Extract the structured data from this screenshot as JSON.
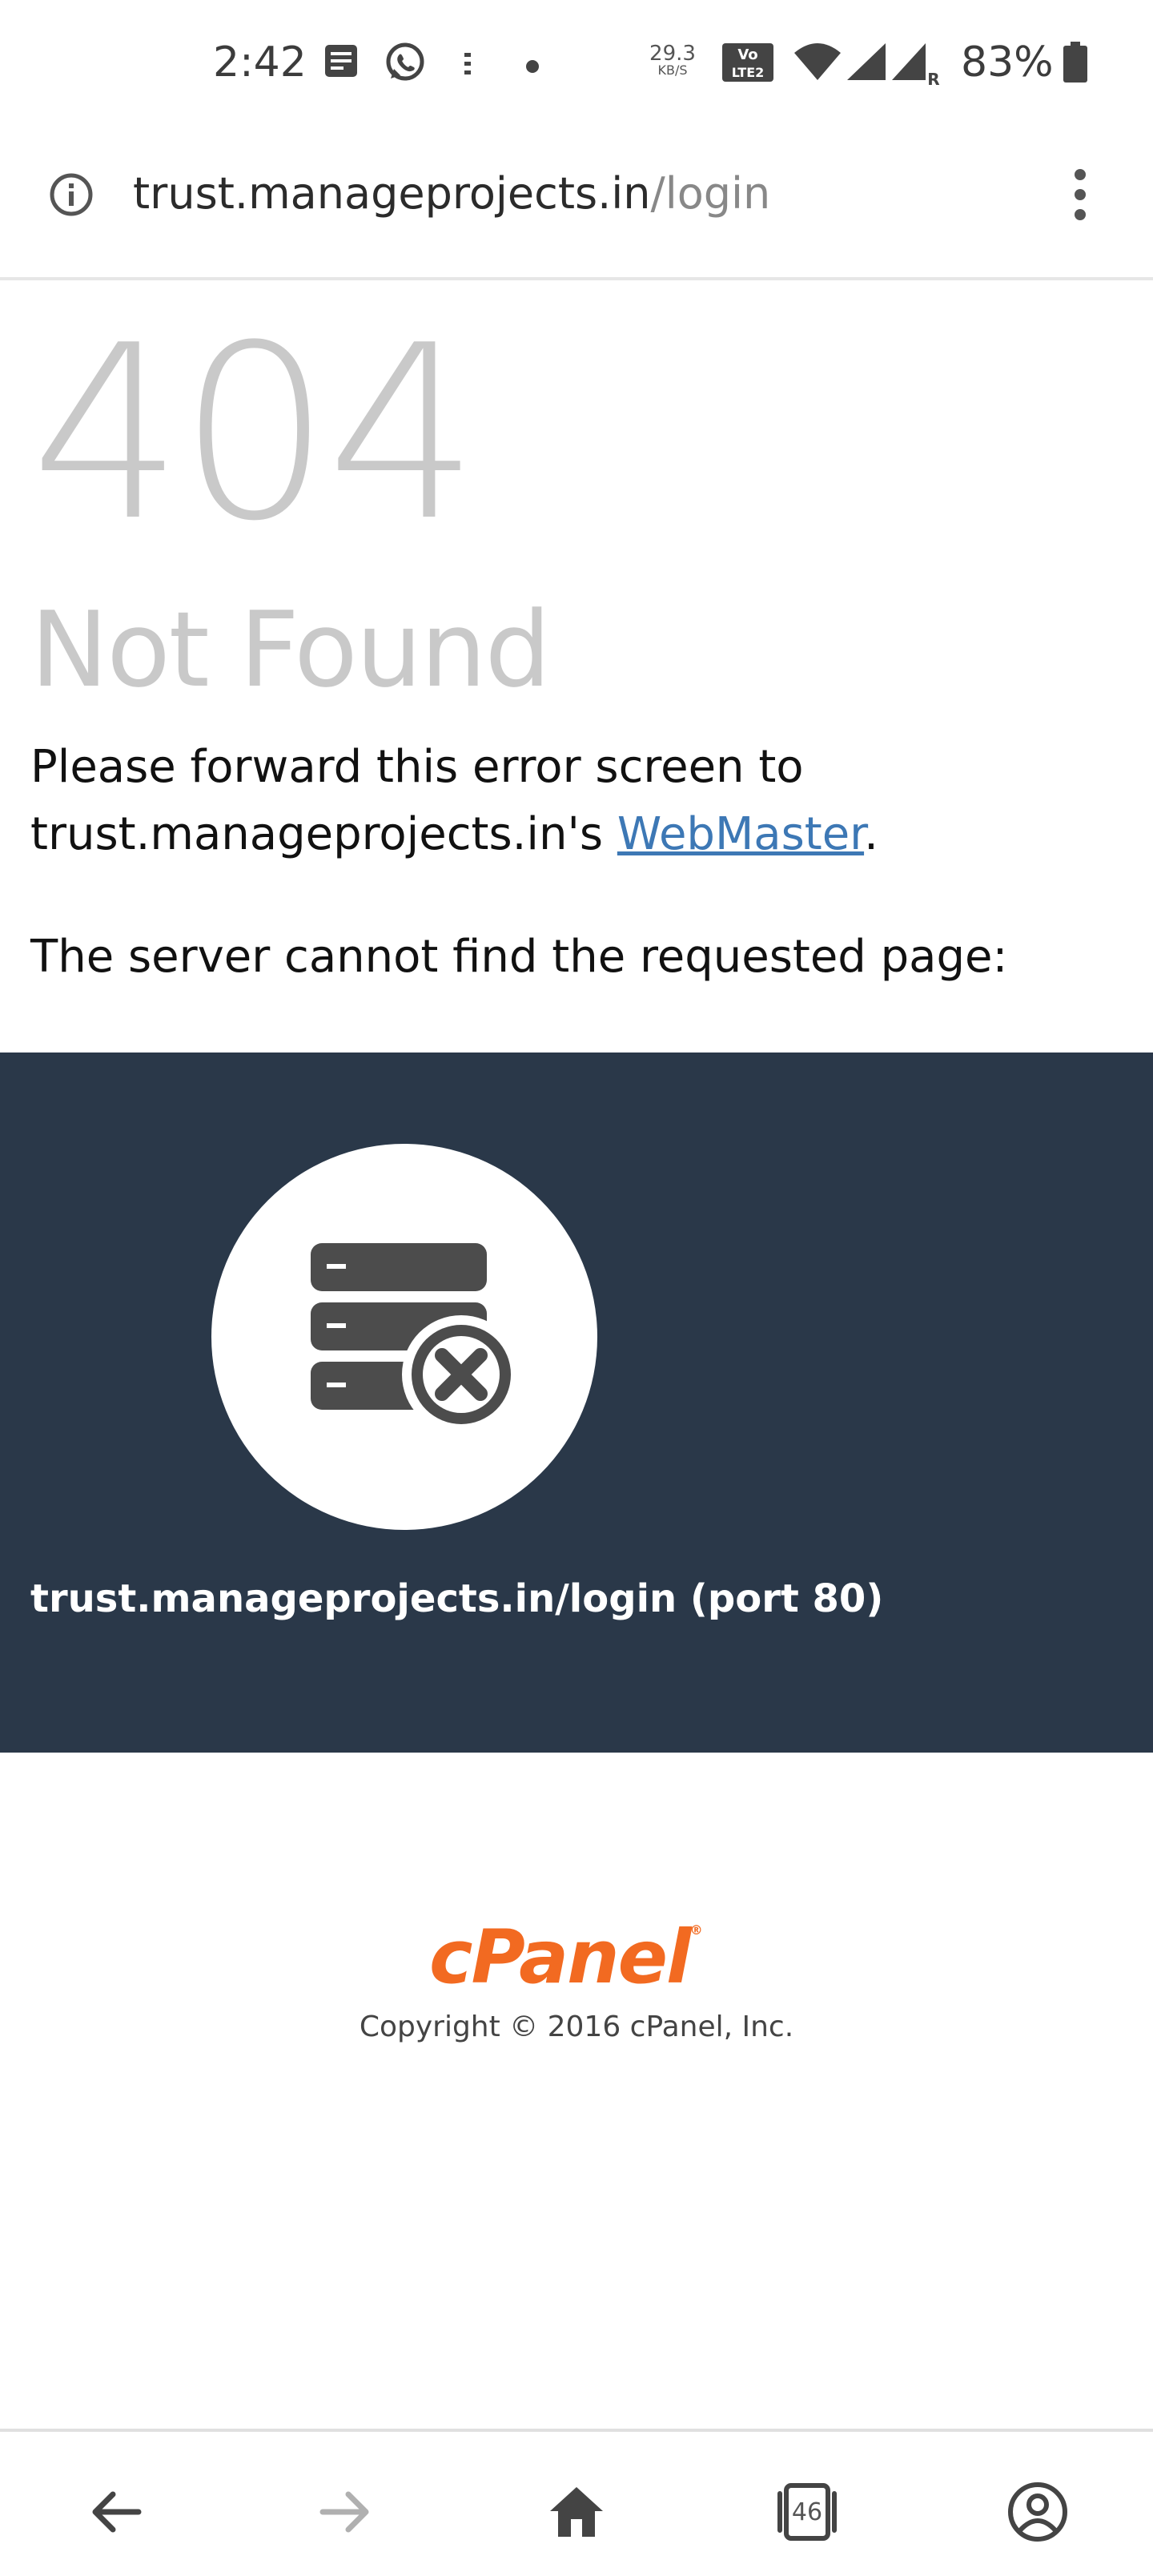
{
  "status_bar": {
    "time": "2:42",
    "net_speed_value": "29.3",
    "net_speed_unit": "KB/S",
    "battery": "83%",
    "icons": [
      "notes-icon",
      "whatsapp-icon",
      "more-notifications-icon",
      "dot-icon",
      "volte-icon",
      "wifi-icon",
      "signal-icon",
      "signal-roaming-icon",
      "battery-icon"
    ]
  },
  "url_bar": {
    "domain": "trust.manageprojects.in",
    "path": "/login"
  },
  "error": {
    "code": "404",
    "title": "Not Found",
    "forward_text": "Please forward this error screen to trust.manageprojects.in's",
    "webmaster_link": "WebMaster",
    "period": ".",
    "server_text": "The server cannot find the requested page:"
  },
  "panel": {
    "requested": "trust.manageprojects.in/login (port 80)",
    "bg_color": "#2a3849"
  },
  "footer": {
    "logo": "cPanel",
    "logo_mark": "®",
    "copyright": "Copyright © 2016 cPanel, Inc.",
    "brand_color": "#f26a21"
  },
  "bottom_nav": {
    "tab_count": "46",
    "items": [
      "back-icon",
      "forward-icon",
      "home-icon",
      "tabs-icon",
      "account-icon"
    ]
  }
}
